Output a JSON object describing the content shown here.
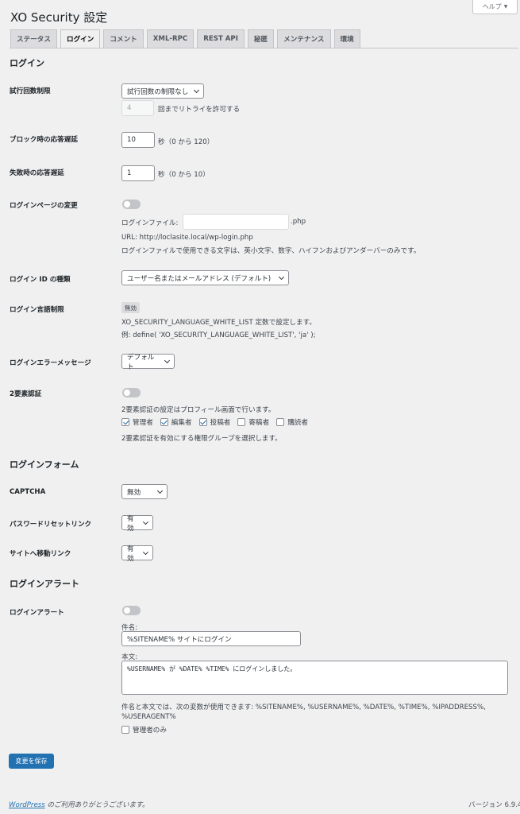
{
  "help_label": "ヘルプ",
  "page_title": "XO Security 設定",
  "tabs": [
    "ステータス",
    "ログイン",
    "コメント",
    "XML-RPC",
    "REST API",
    "秘匿",
    "メンテナンス",
    "環境"
  ],
  "active_tab": "ログイン",
  "sections": {
    "login": "ログイン",
    "login_form": "ログインフォーム",
    "login_alert": "ログインアラート"
  },
  "login": {
    "trial_limit": {
      "label": "試行回数制限",
      "select": "試行回数の制限なし",
      "retry_value": "4",
      "retry_suffix": "回までリトライを許可する"
    },
    "block_delay": {
      "label": "ブロック時の応答遅延",
      "value": "10",
      "suffix": "秒（0 から 120）"
    },
    "fail_delay": {
      "label": "失敗時の応答遅延",
      "value": "1",
      "suffix": "秒（0 から 10）"
    },
    "login_page": {
      "label": "ログインページの変更",
      "file_label": "ログインファイル:",
      "file_value": "",
      "file_ext": ".php",
      "url": "URL: http://loclasite.local/wp-login.php",
      "note": "ログインファイルで使用できる文字は、英小文字、数字、ハイフンおよびアンダーバーのみです。"
    },
    "login_id_type": {
      "label": "ログイン ID の種類",
      "select": "ユーザー名またはメールアドレス (デフォルト)"
    },
    "language_limit": {
      "label": "ログイン言語制限",
      "badge": "無効",
      "line1": "XO_SECURITY_LANGUAGE_WHITE_LIST 定数で設定します。",
      "line2": "例: define( 'XO_SECURITY_LANGUAGE_WHITE_LIST', 'ja' );"
    },
    "error_message": {
      "label": "ログインエラーメッセージ",
      "select": "デフォルト"
    },
    "two_factor": {
      "label": "2要素認証",
      "note1": "2要素認証の設定はプロフィール画面で行います。",
      "roles": [
        {
          "label": "管理者",
          "checked": true
        },
        {
          "label": "編集者",
          "checked": true
        },
        {
          "label": "投稿者",
          "checked": true
        },
        {
          "label": "寄稿者",
          "checked": false
        },
        {
          "label": "購読者",
          "checked": false
        }
      ],
      "note2": "2要素認証を有効にする権限グループを選択します。"
    }
  },
  "login_form": {
    "captcha": {
      "label": "CAPTCHA",
      "select": "無効"
    },
    "password_reset": {
      "label": "パスワードリセットリンク",
      "select": "有効"
    },
    "site_link": {
      "label": "サイトへ移動リンク",
      "select": "有効"
    }
  },
  "login_alert": {
    "label": "ログインアラート",
    "subject_label": "件名:",
    "subject_value": "%SITENAME% サイトにログイン",
    "body_label": "本文:",
    "body_value": "%USERNAME% が %DATE% %TIME% にログインしました。",
    "vars_line1": "件名と本文では、次の変数が使用できます: %SITENAME%, %USERNAME%, %DATE%, %TIME%, %IPADDRESS%,",
    "vars_line2": "%USERAGENT%",
    "admin_only": "管理者のみ"
  },
  "save_label": "変更を保存",
  "footer": {
    "link": "WordPress",
    "thanks": " のご利用ありがとうございます。",
    "version": "バージョン 6.9.4"
  }
}
